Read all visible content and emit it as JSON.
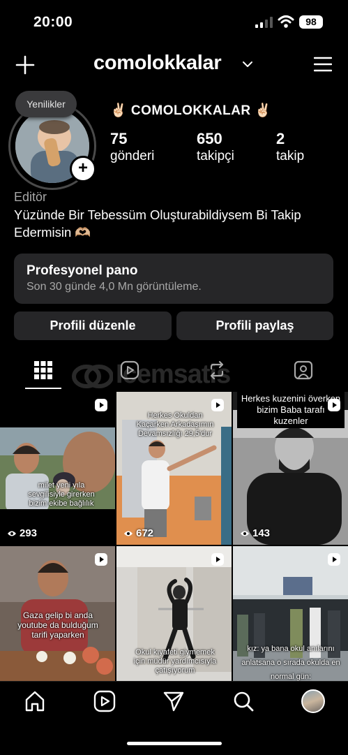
{
  "status": {
    "time": "20:00",
    "battery": "98"
  },
  "header": {
    "username": "comolokkalar"
  },
  "profile": {
    "news_badge": "Yenilikler",
    "display_name": "✌🏻 COMOLOKKALAR ✌🏻",
    "stats": [
      {
        "value": "75",
        "label": "gönderi"
      },
      {
        "value": "650",
        "label": "takipçi"
      },
      {
        "value": "2",
        "label": "takip"
      }
    ],
    "category": "Editör",
    "bio": "Yüzünde Bir Tebessüm Oluşturabildiysem Bi Takip Edermisin 🫶🏼"
  },
  "dashboard": {
    "title": "Profesyonel pano",
    "subtitle": "Son 30 günde 4,0 Mn görüntüleme."
  },
  "buttons": {
    "edit": "Profili düzenle",
    "share": "Profili paylaş"
  },
  "watermark": "Icemsatis",
  "grid": [
    {
      "caption": "milet yeni yıla sevgilisiyle girerken bizim ekibe bağlılık",
      "views": "293"
    },
    {
      "caption": "Herkes Okuldan Kaçarken Arkadaşımın Devamsızlığı 29,5'dur",
      "views": "672"
    },
    {
      "caption": "Herkes kuzenini överken bizim Baba tarafı kuzenler",
      "views": "143"
    },
    {
      "caption": "Gaza gelip bi anda youtube da bulduğum tarifi yaparken",
      "views": ""
    },
    {
      "caption": "Okul kıyafeti giymemek için müdür yardımcısıyla çatışıyorum",
      "views": ""
    },
    {
      "caption": "kız: ya bana okul anılarını anlatsana o sırada okulda en normal gün:",
      "views": ""
    }
  ],
  "icons": {
    "header": [
      "plus-icon",
      "chevron-down-icon",
      "menu-icon"
    ],
    "tabs": [
      "grid-icon",
      "reels-icon",
      "reposts-icon",
      "tagged-icon"
    ],
    "nav": [
      "home-icon",
      "reels-icon",
      "send-icon",
      "search-icon",
      "profile-avatar"
    ]
  },
  "colors": {
    "background": "#000000",
    "card": "#262628",
    "secondary_text": "#a8a8a8"
  }
}
